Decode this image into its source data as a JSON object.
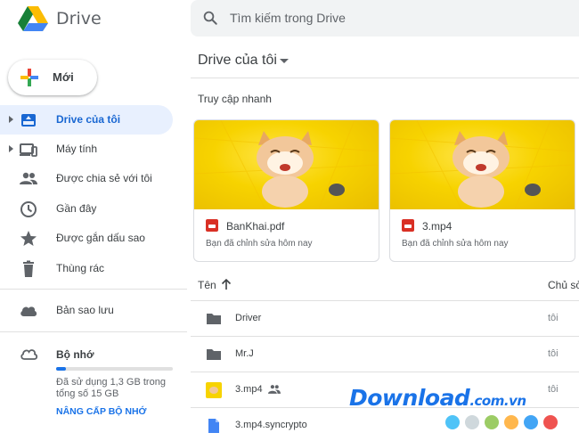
{
  "app": {
    "name": "Drive"
  },
  "search": {
    "placeholder": "Tìm kiếm trong Drive"
  },
  "new_button": {
    "label": "Mới"
  },
  "sidebar": {
    "items": [
      {
        "label": "Drive của tôi",
        "icon": "my-drive-icon",
        "active": true,
        "expandable": true
      },
      {
        "label": "Máy tính",
        "icon": "computer-icon",
        "active": false,
        "expandable": true
      },
      {
        "label": "Được chia sẻ với tôi",
        "icon": "shared-people-icon",
        "active": false
      },
      {
        "label": "Gần đây",
        "icon": "clock-icon",
        "active": false
      },
      {
        "label": "Được gắn dấu sao",
        "icon": "star-icon",
        "active": false
      },
      {
        "label": "Thùng rác",
        "icon": "trash-icon",
        "active": false
      },
      {
        "label": "Bản sao lưu",
        "icon": "cloud-icon",
        "active": false
      }
    ],
    "storage": {
      "label": "Bộ nhớ",
      "icon": "cloud-outline-icon",
      "used_fraction": 0.087,
      "text": "Đã sử dụng 1,3 GB trong tổng số 15 GB",
      "upgrade": "NÂNG CẤP BỘ NHỚ"
    }
  },
  "main": {
    "title": "Drive của tôi",
    "quick_access": {
      "label": "Truy cập nhanh",
      "cards": [
        {
          "name": "BanKhai.pdf",
          "subtitle": "Bạn đã chỉnh sửa hôm nay"
        },
        {
          "name": "3.mp4",
          "subtitle": "Bạn đã chỉnh sửa hôm nay"
        }
      ]
    },
    "list": {
      "header_name": "Tên",
      "header_owner": "Chủ sở",
      "rows": [
        {
          "name": "Driver",
          "icon": "folder-icon",
          "owner": "tôi"
        },
        {
          "name": "Mr.J",
          "icon": "folder-icon",
          "owner": "tôi"
        },
        {
          "name": "3.mp4",
          "icon": "video-thumbnail-icon",
          "owner": "tôi",
          "shared": true
        },
        {
          "name": "3.mp4.syncrypto",
          "icon": "file-icon",
          "owner": ""
        }
      ]
    }
  },
  "watermark": {
    "text": "Download",
    "suffix": ".com.vn"
  },
  "colors": {
    "accent": "#1a73e8",
    "active_bg": "#e8f0fe",
    "dots": [
      "#4fc3f7",
      "#cfd8dc",
      "#9ccc65",
      "#ffb74d",
      "#42a5f5",
      "#ef5350"
    ]
  }
}
